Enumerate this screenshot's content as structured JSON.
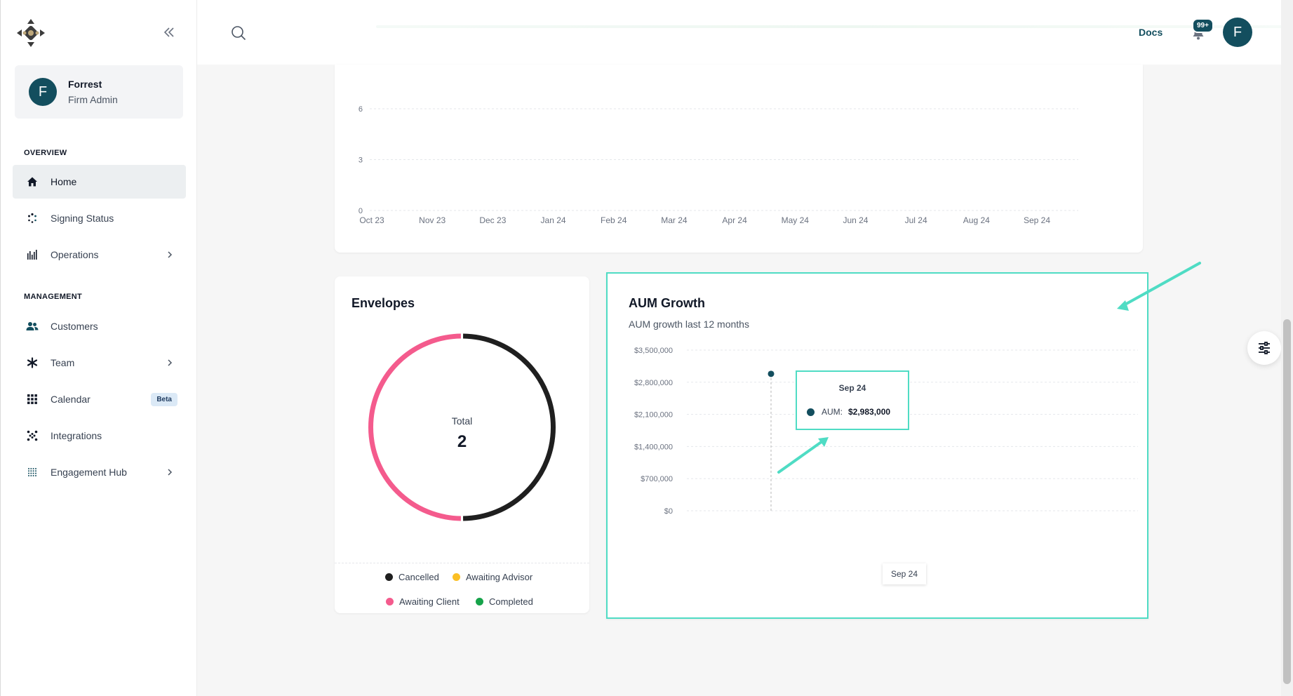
{
  "sidebar": {
    "user": {
      "initial": "F",
      "name": "Forrest",
      "role": "Firm Admin"
    },
    "sections": {
      "overview": "OVERVIEW",
      "management": "MANAGEMENT"
    },
    "items": [
      {
        "label": "Home",
        "icon": "home-icon",
        "active": true
      },
      {
        "label": "Signing Status",
        "icon": "spinner-icon"
      },
      {
        "label": "Operations",
        "icon": "bar-chart-icon",
        "has_chevron": true
      },
      {
        "label": "Customers",
        "icon": "users-icon"
      },
      {
        "label": "Team",
        "icon": "asterisk-icon",
        "has_chevron": true
      },
      {
        "label": "Calendar",
        "icon": "grid-icon",
        "badge": "Beta"
      },
      {
        "label": "Integrations",
        "icon": "dots-icon"
      },
      {
        "label": "Engagement Hub",
        "icon": "dot-grid-icon",
        "has_chevron": true
      }
    ]
  },
  "topbar": {
    "docs": "Docs",
    "notifications": "99+",
    "avatar_initial": "F"
  },
  "envelopes": {
    "title": "Envelopes",
    "total_label": "Total",
    "total_value": "2",
    "legend": [
      {
        "label": "Cancelled",
        "color": "#1f1f1f"
      },
      {
        "label": "Awaiting Advisor",
        "color": "#fbbf24"
      },
      {
        "label": "Awaiting Client",
        "color": "#f45b8d"
      },
      {
        "label": "Completed",
        "color": "#16a34a"
      }
    ]
  },
  "aum": {
    "title": "AUM Growth",
    "subtitle": "AUM growth last 12 months",
    "tooltip": {
      "date": "Sep 24",
      "label": "AUM:",
      "value": "$2,983,000"
    },
    "x_tooltip": "Sep 24"
  },
  "chart_data": [
    {
      "type": "line",
      "x": [
        "Oct 23",
        "Nov 23",
        "Dec 23",
        "Jan 24",
        "Feb 24",
        "Mar 24",
        "Apr 24",
        "May 24",
        "Jun 24",
        "Jul 24",
        "Aug 24",
        "Sep 24"
      ],
      "yticks": [
        "0",
        "3",
        "6"
      ],
      "ylim": [
        0,
        6
      ],
      "grid": true
    },
    {
      "type": "pie",
      "categories": [
        "Cancelled",
        "Awaiting Client"
      ],
      "values": [
        1,
        1
      ],
      "colors": [
        "#1f1f1f",
        "#f45b8d"
      ],
      "title": "Envelopes"
    },
    {
      "type": "line",
      "title": "AUM Growth",
      "x": [
        "Sep 24"
      ],
      "series": [
        {
          "name": "AUM",
          "values": [
            2983000
          ]
        }
      ],
      "yticks": [
        "$0",
        "$700,000",
        "$1,400,000",
        "$2,100,000",
        "$2,800,000",
        "$3,500,000"
      ],
      "ylim": [
        0,
        3500000
      ],
      "grid": true
    }
  ]
}
